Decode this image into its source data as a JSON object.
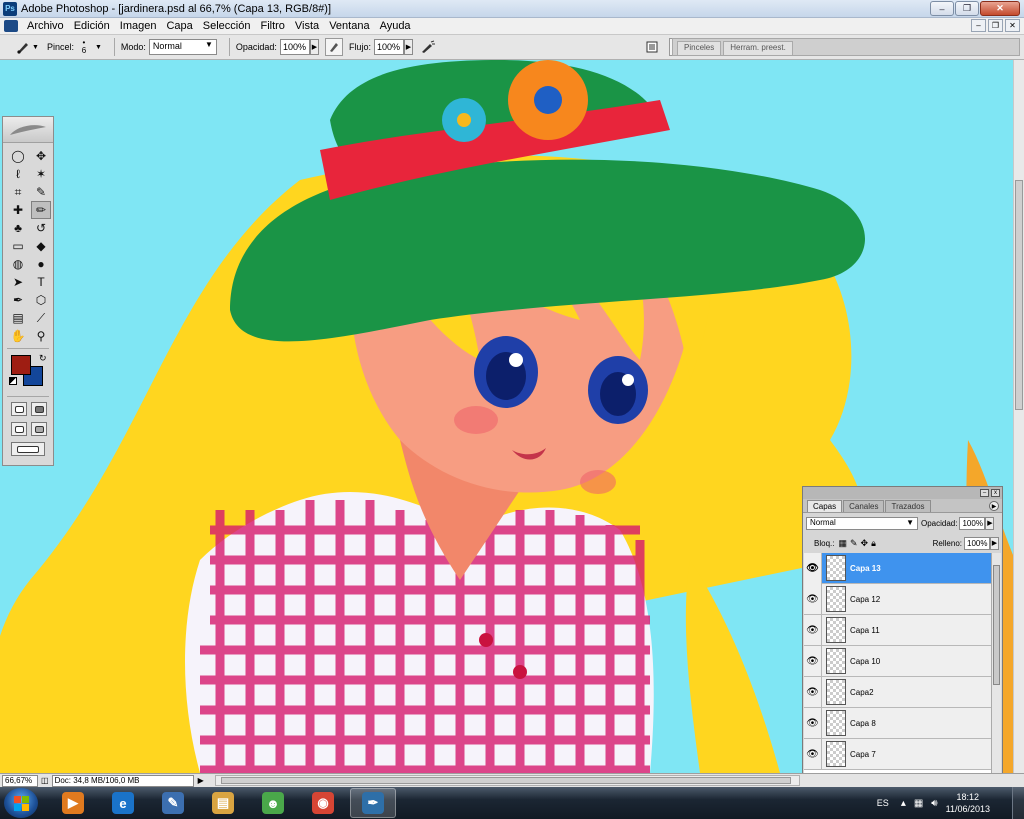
{
  "window": {
    "title": "Adobe Photoshop - [jardinera.psd al 66,7% (Capa 13, RGB/8#)]",
    "app_icon_text": "Ps",
    "controls": {
      "minimize": "–",
      "maximize": "❐",
      "close": "✕"
    }
  },
  "menu": {
    "items": [
      "Archivo",
      "Edición",
      "Imagen",
      "Capa",
      "Selección",
      "Filtro",
      "Vista",
      "Ventana",
      "Ayuda"
    ],
    "doc_controls": {
      "minimize": "–",
      "restore": "❐",
      "close": "✕"
    }
  },
  "options": {
    "brush_label": "Pincel:",
    "brush_size": "6",
    "mode_label": "Modo:",
    "mode_value": "Normal",
    "opacity_label": "Opacidad:",
    "opacity_value": "100%",
    "flow_label": "Flujo:",
    "flow_value": "100%",
    "well_tabs": [
      "Pinceles",
      "Herram. preest."
    ]
  },
  "toolbox": {
    "tools": [
      {
        "name": "marquee-tool-icon",
        "glyph": "◯",
        "active": false
      },
      {
        "name": "move-tool-icon",
        "glyph": "✥",
        "active": false
      },
      {
        "name": "lasso-tool-icon",
        "glyph": "ℓ",
        "active": false
      },
      {
        "name": "magic-wand-tool-icon",
        "glyph": "✶",
        "active": false
      },
      {
        "name": "crop-tool-icon",
        "glyph": "⌗",
        "active": false
      },
      {
        "name": "slice-tool-icon",
        "glyph": "✎",
        "active": false
      },
      {
        "name": "healing-brush-tool-icon",
        "glyph": "✚",
        "active": false
      },
      {
        "name": "brush-tool-icon",
        "glyph": "✏",
        "active": true
      },
      {
        "name": "clone-stamp-tool-icon",
        "glyph": "♣",
        "active": false
      },
      {
        "name": "history-brush-tool-icon",
        "glyph": "↺",
        "active": false
      },
      {
        "name": "eraser-tool-icon",
        "glyph": "▭",
        "active": false
      },
      {
        "name": "paint-bucket-tool-icon",
        "glyph": "◆",
        "active": false
      },
      {
        "name": "blur-tool-icon",
        "glyph": "◍",
        "active": false
      },
      {
        "name": "dodge-tool-icon",
        "glyph": "●",
        "active": false
      },
      {
        "name": "path-selection-tool-icon",
        "glyph": "➤",
        "active": false
      },
      {
        "name": "type-tool-icon",
        "glyph": "T",
        "active": false
      },
      {
        "name": "pen-tool-icon",
        "glyph": "✒",
        "active": false
      },
      {
        "name": "shape-tool-icon",
        "glyph": "⬡",
        "active": false
      },
      {
        "name": "notes-tool-icon",
        "glyph": "▤",
        "active": false
      },
      {
        "name": "eyedropper-tool-icon",
        "glyph": "⟋",
        "active": false
      },
      {
        "name": "hand-tool-icon",
        "glyph": "✋",
        "active": false
      },
      {
        "name": "zoom-tool-icon",
        "glyph": "⚲",
        "active": false
      }
    ],
    "foreground_color": "#9e1d12",
    "background_color": "#13469a"
  },
  "layers_panel": {
    "tabs": [
      "Capas",
      "Canales",
      "Trazados"
    ],
    "active_tab": "Capas",
    "blend_mode": "Normal",
    "opacity_label": "Opacidad:",
    "opacity_value": "100%",
    "lock_label": "Bloq.:",
    "fill_label": "Relleno:",
    "fill_value": "100%",
    "layers": [
      {
        "name": "Capa 13",
        "selected": true
      },
      {
        "name": "Capa 12",
        "selected": false
      },
      {
        "name": "Capa 11",
        "selected": false
      },
      {
        "name": "Capa 10",
        "selected": false
      },
      {
        "name": "Capa2",
        "selected": false
      },
      {
        "name": "Capa 8",
        "selected": false
      },
      {
        "name": "Capa 7",
        "selected": false
      }
    ]
  },
  "status": {
    "zoom": "66,67%",
    "doc_info": "Doc: 34,8 MB/106,0 MB"
  },
  "taskbar": {
    "language": "ES",
    "time": "18:12",
    "date": "11/06/2013",
    "apps": [
      {
        "name": "media-player-icon",
        "glyph": "▶",
        "color": "#e07a1f",
        "active": false
      },
      {
        "name": "internet-explorer-icon",
        "glyph": "e",
        "color": "#1a73c9",
        "active": false
      },
      {
        "name": "paint-app-icon",
        "glyph": "✎",
        "color": "#3c6fb0",
        "active": false
      },
      {
        "name": "file-explorer-icon",
        "glyph": "▤",
        "color": "#d9a441",
        "active": false
      },
      {
        "name": "messenger-icon",
        "glyph": "☻",
        "color": "#4aa84a",
        "active": false
      },
      {
        "name": "chrome-icon",
        "glyph": "◉",
        "color": "#d64534",
        "active": false
      },
      {
        "name": "photoshop-taskbar-icon",
        "glyph": "✒",
        "color": "#2e6fa8",
        "active": true
      }
    ]
  }
}
